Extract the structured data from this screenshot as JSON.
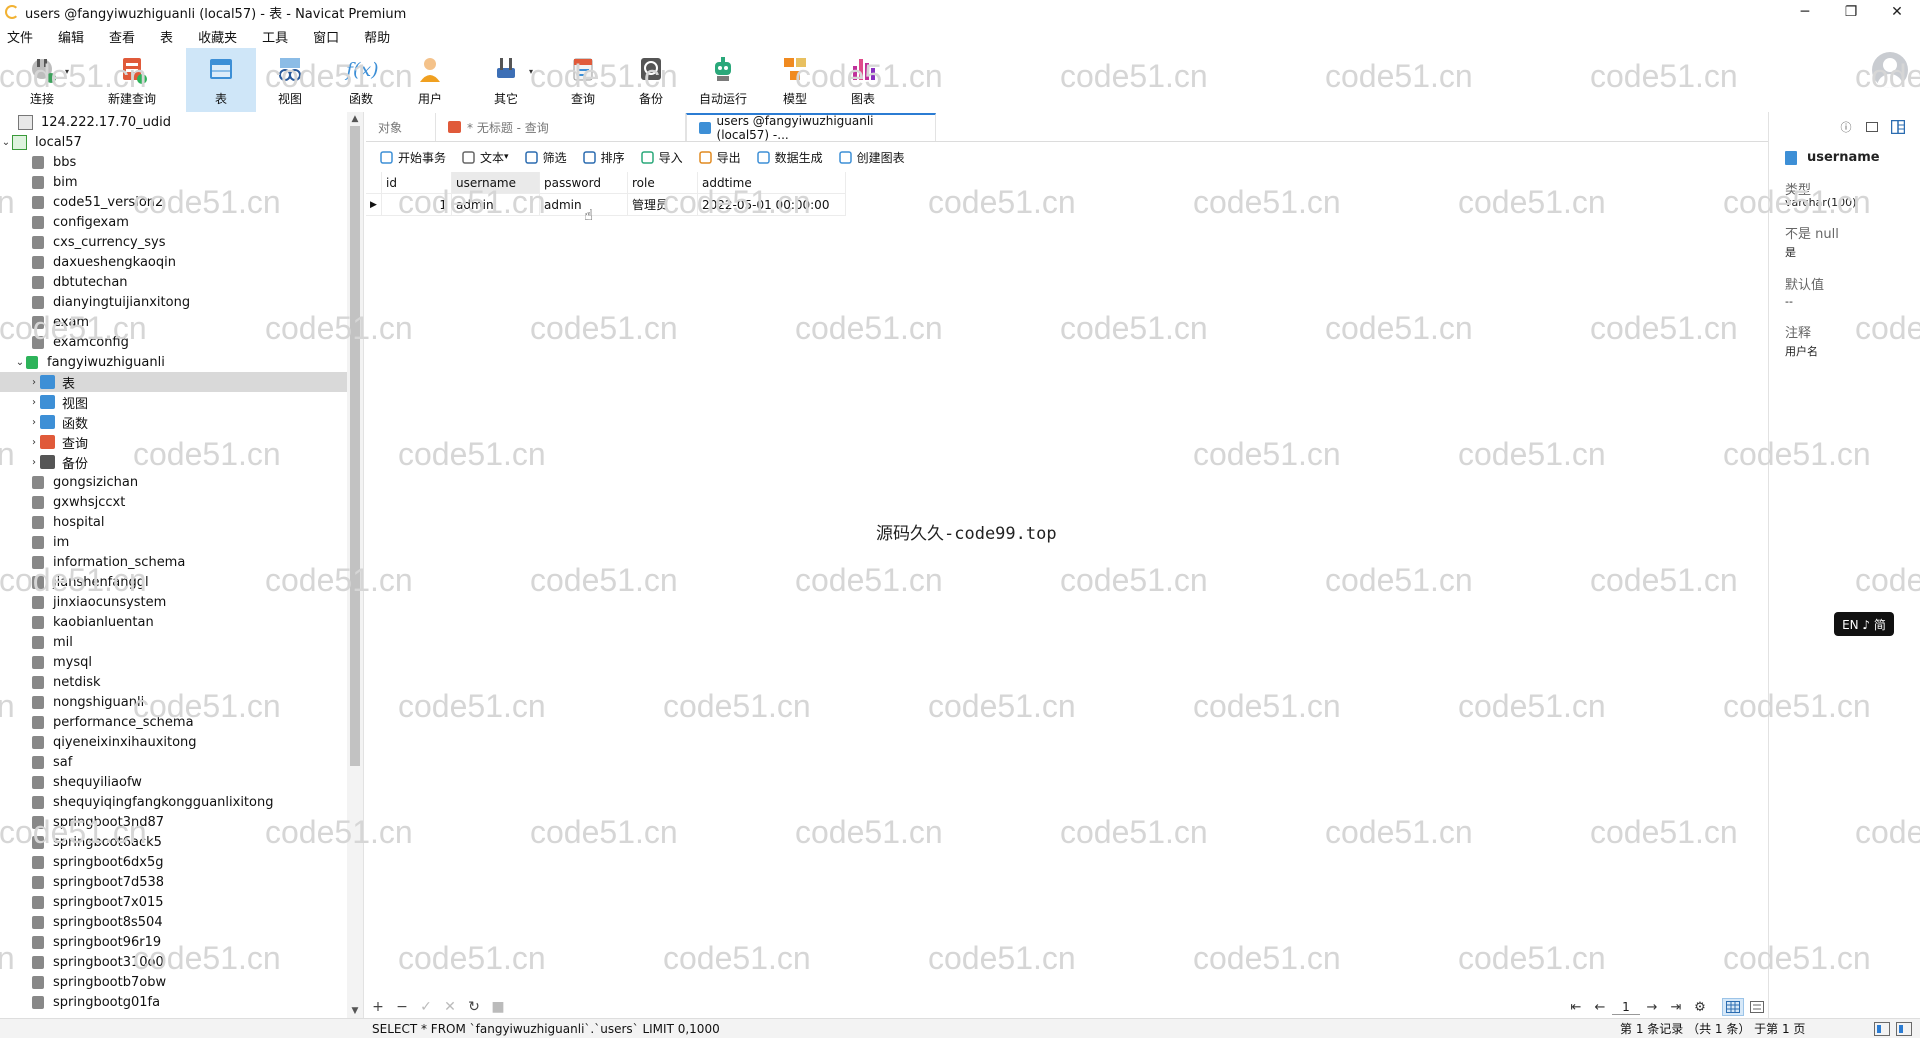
{
  "window": {
    "title": "users @fangyiwuzhiguanli (local57) - 表 - Navicat Premium",
    "controls": {
      "minimize": "─",
      "maximize": "❐",
      "close": "✕"
    }
  },
  "menu": [
    "文件",
    "编辑",
    "查看",
    "表",
    "收藏夹",
    "工具",
    "窗口",
    "帮助"
  ],
  "toolbar": [
    {
      "label": "连接",
      "icon": "plug-icon",
      "color": "#8a8a8a",
      "dropdown": true
    },
    {
      "label": "新建查询",
      "icon": "new-query-icon",
      "color": "#e05a3a"
    },
    {
      "label": "表",
      "icon": "table-icon",
      "color": "#3d8fd6",
      "active": true
    },
    {
      "label": "视图",
      "icon": "view-icon",
      "color": "#3d8fd6"
    },
    {
      "label": "函数",
      "icon": "function-icon",
      "color": "#3d8fd6",
      "glyph": "f(x)"
    },
    {
      "label": "用户",
      "icon": "user-icon",
      "color": "#f0a020"
    },
    {
      "label": "其它",
      "icon": "tools-icon",
      "color": "#3d6fb6",
      "dropdown": true
    },
    {
      "label": "查询",
      "icon": "query-icon",
      "color": "#e05a3a"
    },
    {
      "label": "备份",
      "icon": "backup-icon",
      "color": "#555555"
    },
    {
      "label": "自动运行",
      "icon": "robot-icon",
      "color": "#2aa87a"
    },
    {
      "label": "模型",
      "icon": "model-icon",
      "color": "#f08a20"
    },
    {
      "label": "图表",
      "icon": "chart-icon",
      "color": "#c0309a"
    }
  ],
  "tree": {
    "connections": [
      {
        "label": "124.222.17.70_udid",
        "expanded": false
      },
      {
        "label": "local57",
        "expanded": true
      }
    ],
    "databases": [
      "bbs",
      "bim",
      "code51_version2",
      "configexam",
      "cxs_currency_sys",
      "daxueshengkaoqin",
      "dbtutechan",
      "dianyingtuijianxitong",
      "exam",
      "examconfig"
    ],
    "open_database": "fangyiwuzhiguanli",
    "open_children": [
      {
        "label": "表",
        "icon": "table-icon",
        "color": "#3d8fd6",
        "selected": true
      },
      {
        "label": "视图",
        "icon": "view-icon",
        "color": "#3d8fd6"
      },
      {
        "label": "函数",
        "icon": "function-icon",
        "color": "#3d8fd6"
      },
      {
        "label": "查询",
        "icon": "query-icon",
        "color": "#e05a3a"
      },
      {
        "label": "备份",
        "icon": "backup-icon",
        "color": "#555555"
      }
    ],
    "databases_after": [
      "gongsizichan",
      "gxwhsjccxt",
      "hospital",
      "im",
      "information_schema",
      "jianshenfanggl",
      "jinxiaocunsystem",
      "kaobianluentan",
      "mil",
      "mysql",
      "netdisk",
      "nongshiguanli",
      "performance_schema",
      "qiyeneixinxihauxitong",
      "saf",
      "shequyiliaofw",
      "shequyiqingfangkongguanlixitong",
      "springboot3nd87",
      "springboot6ack5",
      "springboot6dx5g",
      "springboot7d538",
      "springboot7x015",
      "springboot8s504",
      "springboot96r19",
      "springboot310o0",
      "springbootb7obw",
      "springbootg01fa"
    ]
  },
  "tabs": [
    {
      "label": "对象",
      "active": false
    },
    {
      "label": "* 无标题 - 查询",
      "active": false,
      "icon": "query-icon"
    },
    {
      "label": "users @fangyiwuzhiguanli (local57) -...",
      "active": true,
      "icon": "table-icon"
    }
  ],
  "subtoolbar": [
    {
      "label": "开始事务",
      "icon": "transaction-icon"
    },
    {
      "label": "文本",
      "icon": "text-icon",
      "dropdown": true
    },
    {
      "label": "筛选",
      "icon": "filter-icon"
    },
    {
      "label": "排序",
      "icon": "sort-icon"
    },
    {
      "label": "导入",
      "icon": "import-icon"
    },
    {
      "label": "导出",
      "icon": "export-icon"
    },
    {
      "label": "数据生成",
      "icon": "data-generate-icon"
    },
    {
      "label": "创建图表",
      "icon": "create-chart-icon"
    }
  ],
  "grid": {
    "columns": [
      "id",
      "username",
      "password",
      "role",
      "addtime"
    ],
    "rows": [
      [
        "1",
        "admin",
        "admin",
        "管理员",
        "2022-05-01 00:00:00"
      ]
    ]
  },
  "overlay_text": "源码久久-code99.top",
  "watermark": "code51.cn",
  "navbar": {
    "buttons": [
      "+",
      "−",
      "✓",
      "✕",
      "↻",
      "■"
    ],
    "pager": {
      "first": "⇤",
      "prev": "←",
      "page": "1",
      "next": "→",
      "last": "⇥",
      "settings": "⚙"
    }
  },
  "info_panel": {
    "field_name": "username",
    "type_label": "类型",
    "type_value": "varchar(100)",
    "notnull_label": "不是 null",
    "notnull_value": "是",
    "default_label": "默认值",
    "default_value": "--",
    "comment_label": "注释",
    "comment_value": "用户名"
  },
  "ime": "EN ♪ 简",
  "status": {
    "sql": "SELECT * FROM `fangyiwuzhiguanli`.`users` LIMIT 0,1000",
    "records": "第 1 条记录 （共 1 条） 于第 1 页"
  }
}
